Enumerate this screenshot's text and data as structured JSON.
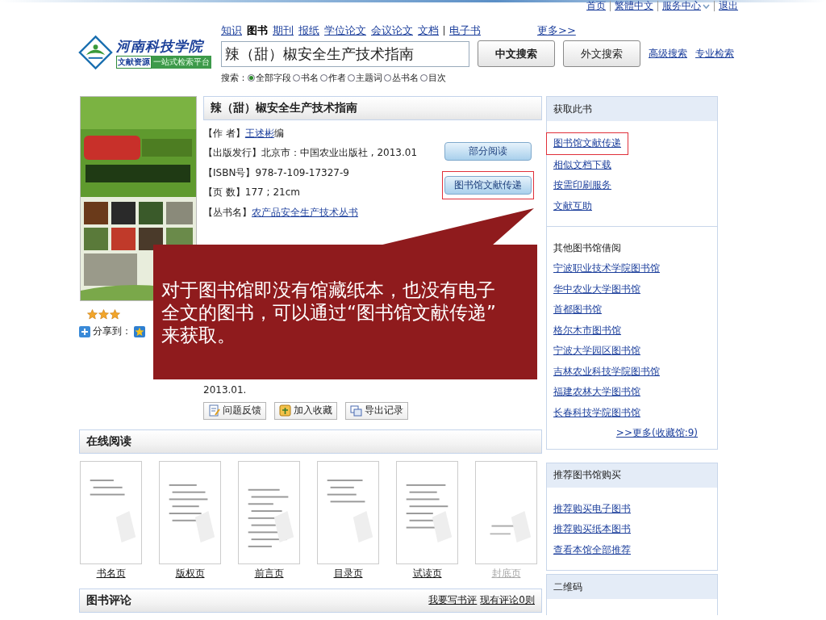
{
  "top_links": [
    {
      "label": "首页",
      "caret": false
    },
    {
      "label": "繁體中文",
      "caret": false
    },
    {
      "label": "服务中心",
      "caret": true
    },
    {
      "label": "退出",
      "caret": false
    }
  ],
  "logo": {
    "name": "河南科技学院",
    "tag_1": "文献资源",
    "tag_2": "一站式检索平台"
  },
  "nav": {
    "items": [
      {
        "label": "知识",
        "selected": false
      },
      {
        "label": "图书",
        "selected": true
      },
      {
        "label": "期刊",
        "selected": false
      },
      {
        "label": "报纸",
        "selected": false
      },
      {
        "label": "学位论文",
        "selected": false
      },
      {
        "label": "会议论文",
        "selected": false
      },
      {
        "label": "文档",
        "selected": false
      },
      {
        "label": "电子书",
        "selected": false
      }
    ],
    "more": "更多>>"
  },
  "search": {
    "value": "辣（甜）椒安全生产技术指南",
    "buttons": [
      {
        "label": "中文搜索",
        "primary": true
      },
      {
        "label": "外文搜索",
        "primary": false
      }
    ],
    "links": [
      "高级搜索",
      "专业检索"
    ],
    "scope_label": "搜索：",
    "scopes": [
      {
        "label": "全部字段",
        "selected": true
      },
      {
        "label": "书名",
        "selected": false
      },
      {
        "label": "作者",
        "selected": false
      },
      {
        "label": "主题词",
        "selected": false
      },
      {
        "label": "丛书名",
        "selected": false
      },
      {
        "label": "目次",
        "selected": false
      }
    ]
  },
  "book": {
    "title": "辣（甜）椒安全生产技术指南",
    "fields": [
      {
        "label": "【作 者】",
        "parts": [
          {
            "kind": "link",
            "text": "王述彬"
          },
          {
            "kind": "text",
            "text": "编"
          }
        ]
      },
      {
        "label": "【出版发行】",
        "parts": [
          {
            "kind": "text",
            "text": "北京市：中国农业出版社 , 2013.01"
          }
        ]
      },
      {
        "label": "【ISBN号】",
        "parts": [
          {
            "kind": "text",
            "text": "978-7-109-17327-9"
          }
        ]
      },
      {
        "label": "【页 数】",
        "parts": [
          {
            "kind": "text",
            "text": "177 ; 21cm"
          }
        ]
      },
      {
        "label": "【丛书名】",
        "parts": [
          {
            "kind": "link",
            "text": "农产品安全生产技术丛书"
          }
        ]
      }
    ],
    "actions": [
      {
        "label": "部分阅读",
        "highlighted": false
      },
      {
        "label": "图书馆文献传递",
        "highlighted": true
      }
    ],
    "citation_tail": "2013.01.",
    "tools": [
      {
        "kind": "feedback",
        "label": "问题反馈"
      },
      {
        "kind": "favorite",
        "label": "加入收藏"
      },
      {
        "kind": "export",
        "label": "导出记录"
      }
    ],
    "rating": {
      "stars": 3
    },
    "share_label": "分享到："
  },
  "callout": {
    "lines": [
      "对于图书馆即没有馆藏纸本，也没有电子",
      "全文的图书，可以通过“图书馆文献传递”",
      "来获取。"
    ]
  },
  "online_reading": {
    "title": "在线阅读",
    "pages": [
      {
        "label": "书名页",
        "faded": false
      },
      {
        "label": "版权页",
        "faded": false
      },
      {
        "label": "前言页",
        "faded": false
      },
      {
        "label": "目录页",
        "faded": false
      },
      {
        "label": "试读页",
        "faded": false
      },
      {
        "label": "封底页",
        "faded": true
      }
    ]
  },
  "reviews": {
    "title": "图书评论",
    "links": [
      "我要写书评",
      "现有评论0则"
    ]
  },
  "sidebar": {
    "get_book": {
      "title": "获取此书",
      "links": [
        {
          "label": "图书馆文献传递",
          "highlighted": true
        },
        {
          "label": "相似文档下载",
          "highlighted": false
        },
        {
          "label": "按需印刷服务",
          "highlighted": false
        },
        {
          "label": "文献互助",
          "highlighted": false
        }
      ]
    },
    "other_libraries": {
      "title": "其他图书馆借阅",
      "links": [
        "宁波职业技术学院图书馆",
        "华中农业大学图书馆",
        "首都图书馆",
        "格尔木市图书馆",
        "宁波大学园区图书馆",
        "吉林农业科技学院图书馆",
        "福建农林大学图书馆",
        "长春科技学院图书馆"
      ],
      "more": ">>更多(收藏馆:9)"
    },
    "purchase": {
      "title": "推荐图书馆购买",
      "links": [
        "推荐购买电子图书",
        "推荐购买纸本图书",
        "查看本馆全部推荐"
      ]
    },
    "qr": {
      "title": "二维码"
    }
  }
}
